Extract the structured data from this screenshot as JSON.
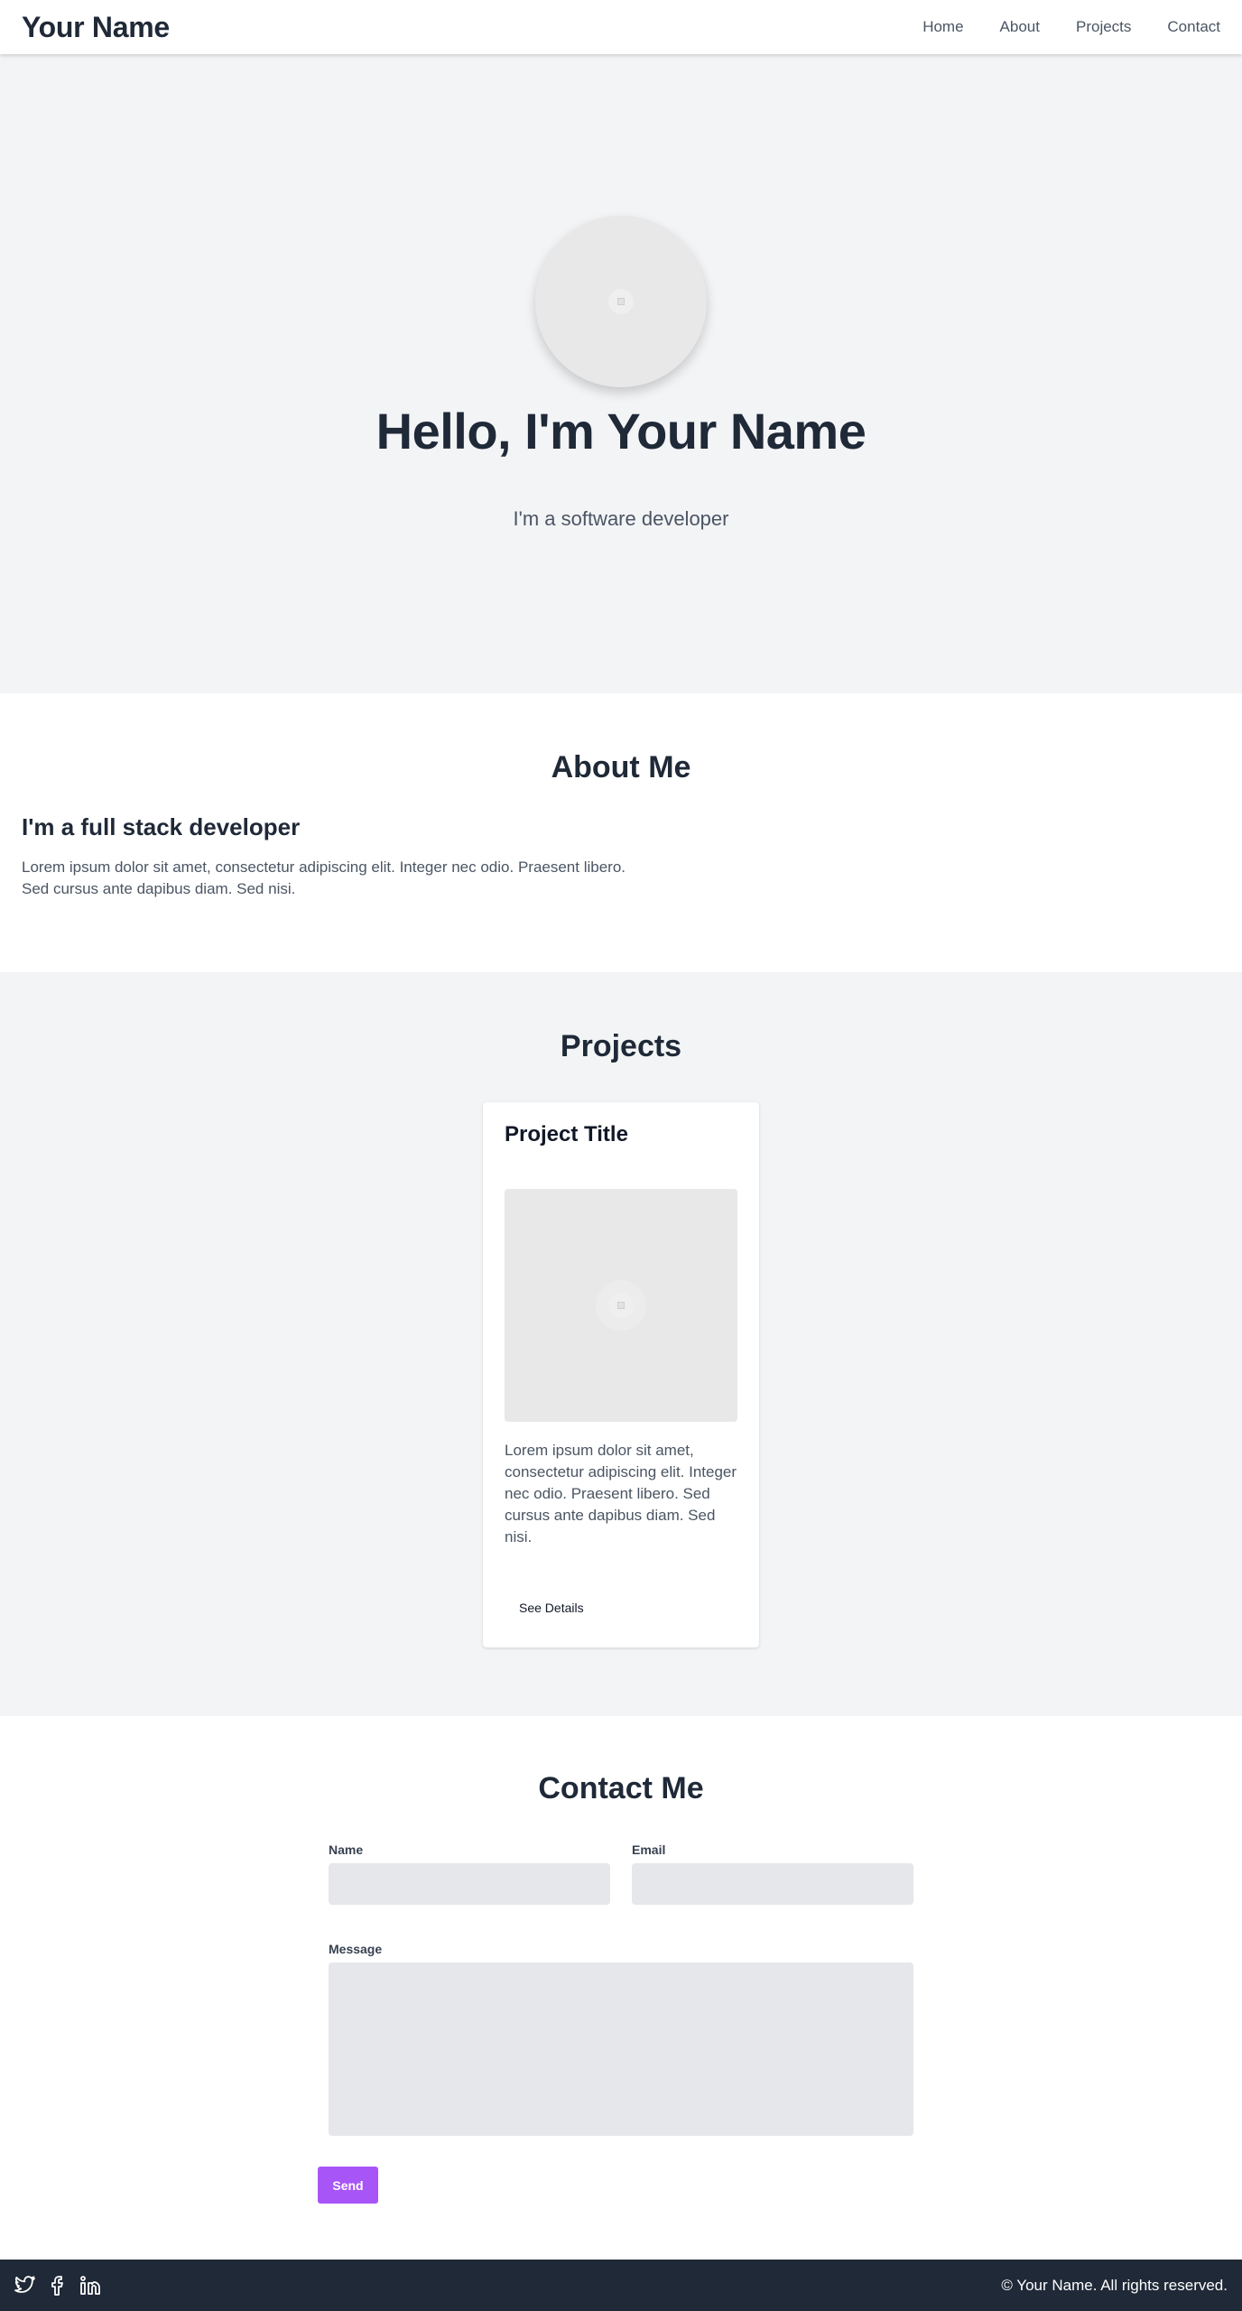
{
  "header": {
    "brand": "Your Name",
    "nav": [
      "Home",
      "About",
      "Projects",
      "Contact"
    ]
  },
  "hero": {
    "title": "Hello, I'm Your Name",
    "subtitle": "I'm a software developer"
  },
  "about": {
    "title": "About Me",
    "heading": "I'm a full stack developer",
    "text": "Lorem ipsum dolor sit amet, consectetur adipiscing elit. Integer nec odio. Praesent libero. Sed cursus ante dapibus diam. Sed nisi."
  },
  "projects": {
    "title": "Projects",
    "cards": [
      {
        "title": "Project Title",
        "text": "Lorem ipsum dolor sit amet, consectetur adipiscing elit. Integer nec odio. Praesent libero. Sed cursus ante dapibus diam. Sed nisi.",
        "button": "See Details"
      }
    ]
  },
  "contact": {
    "title": "Contact Me",
    "name_label": "Name",
    "email_label": "Email",
    "message_label": "Message",
    "send": "Send"
  },
  "footer": {
    "socials": [
      "twitter-icon",
      "facebook-icon",
      "linkedin-icon"
    ],
    "copyright": "© Your Name. All rights reserved."
  },
  "colors": {
    "accent": "#a855f7",
    "dark": "#1f2937",
    "light_bg": "#f3f4f6"
  }
}
